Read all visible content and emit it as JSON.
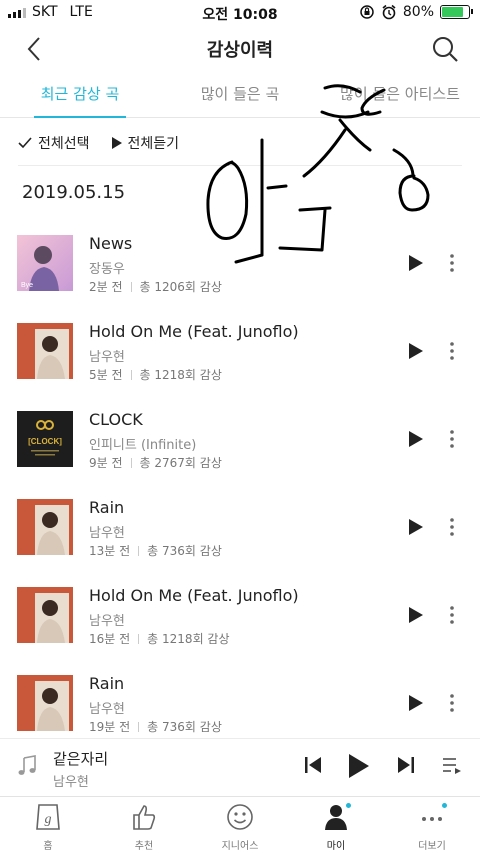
{
  "status": {
    "carrier": "SKT",
    "network": "LTE",
    "time": "오전 10:08",
    "battery": "80%",
    "battery_level": 0.8
  },
  "header": {
    "title": "감상이력"
  },
  "tabs": [
    {
      "label": "최근 감상 곡"
    },
    {
      "label": "많이 들은 곡"
    },
    {
      "label": "많이 들은 아티스트"
    }
  ],
  "actions": {
    "select_all": "전체선택",
    "play_all": "전체듣기"
  },
  "date": "2019.05.15",
  "tracks": [
    {
      "title": "News",
      "artist": "장동우",
      "ago": "2분 전",
      "plays": "총 1206회 감상"
    },
    {
      "title": "Hold On Me (Feat. Junoflo)",
      "artist": "남우현",
      "ago": "5분 전",
      "plays": "총 1218회 감상"
    },
    {
      "title": "CLOCK",
      "artist": "인피니트 (Infinite)",
      "ago": "9분 전",
      "plays": "총 2767회 감상"
    },
    {
      "title": "Rain",
      "artist": "남우현",
      "ago": "13분 전",
      "plays": "총 736회 감상"
    },
    {
      "title": "Hold On Me (Feat. Junoflo)",
      "artist": "남우현",
      "ago": "16분 전",
      "plays": "총 1218회 감상"
    },
    {
      "title": "Rain",
      "artist": "남우현",
      "ago": "19분 전",
      "plays": "총 736회 감상"
    }
  ],
  "album_art": {
    "news_caption": "Bye",
    "clock_caption": "[CLOCK]"
  },
  "player": {
    "title": "같은자리",
    "artist": "남우현"
  },
  "nav": [
    {
      "label": "홈",
      "icon": "genie-home-icon"
    },
    {
      "label": "추천",
      "icon": "thumbs-up-icon"
    },
    {
      "label": "지니어스",
      "icon": "smiley-icon"
    },
    {
      "label": "마이",
      "icon": "person-icon"
    },
    {
      "label": "더보기",
      "icon": "more-dots-icon"
    }
  ],
  "colors": {
    "accent": "#21b7d8",
    "text": "#222222",
    "muted": "#888888"
  }
}
